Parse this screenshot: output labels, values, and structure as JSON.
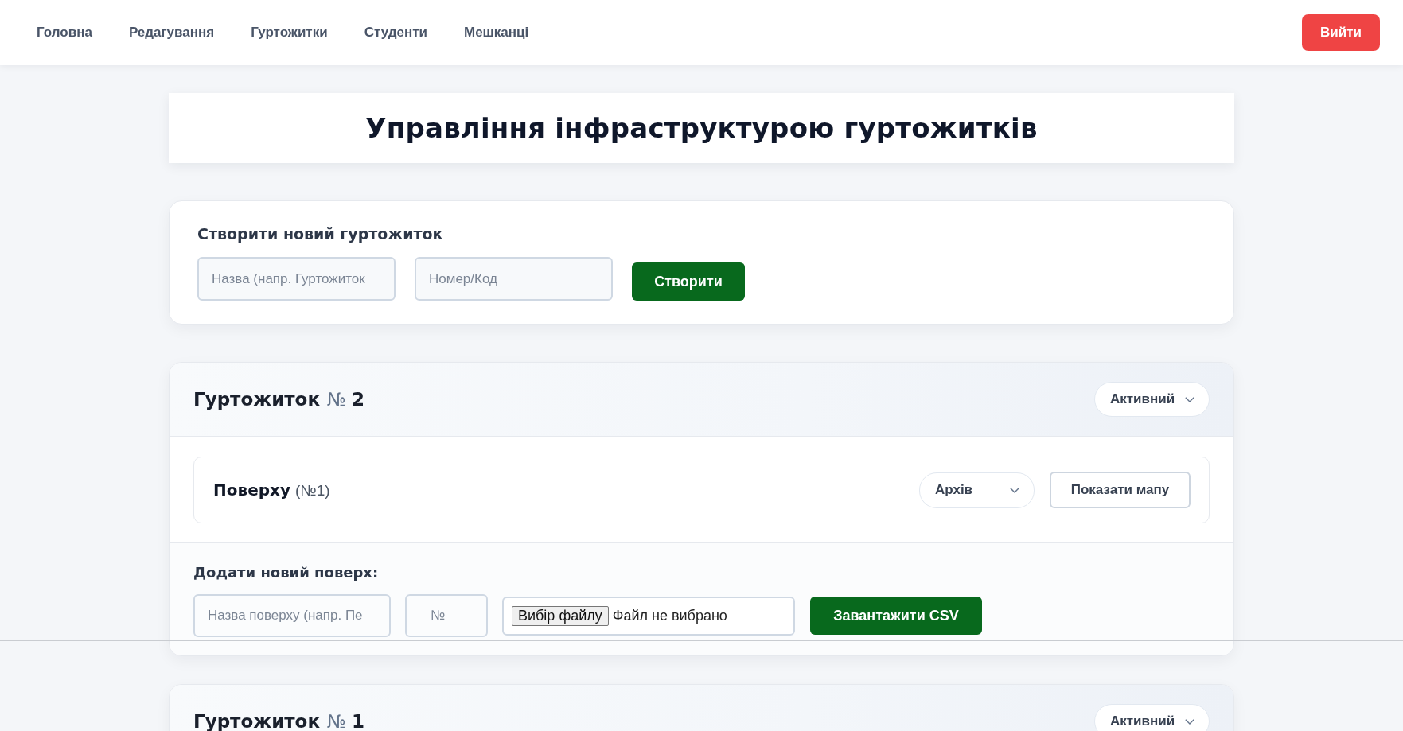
{
  "nav": {
    "links": [
      {
        "label": "Головна"
      },
      {
        "label": "Редагування"
      },
      {
        "label": "Гуртожитки"
      },
      {
        "label": "Студенти"
      },
      {
        "label": "Мешканці"
      }
    ],
    "logout_button": "Вийти"
  },
  "page_title": "Управління інфраструктурою гуртожитків",
  "create_form": {
    "heading": "Створити новий гуртожиток",
    "fields": [
      {
        "placeholder": "Назва (напр. Гуртожиток"
      },
      {
        "placeholder": "Номер/Код"
      }
    ],
    "submit_button": "Створити"
  },
  "dormitories": [
    {
      "title": "Гуртожиток",
      "number_sign": "№",
      "number": "2",
      "status": "Активний",
      "floors": [
        {
          "name": "Поверху",
          "number": "(№1)",
          "status": "Архів",
          "map_button": "Показати мапу"
        }
      ],
      "add_floor": {
        "heading": "Додати новий поверх:",
        "fields": [
          {
            "kind": "name",
            "placeholder": "Назва поверху (напр. Пе"
          },
          {
            "kind": "number",
            "placeholder": "№"
          }
        ],
        "file_input": {
          "button": "Вибір файлу",
          "status": "Файл не вибрано"
        },
        "upload_button": "Завантажити CSV"
      }
    },
    {
      "title": "Гуртожиток",
      "number_sign": "№",
      "number": "1",
      "status": "Активний"
    }
  ]
}
